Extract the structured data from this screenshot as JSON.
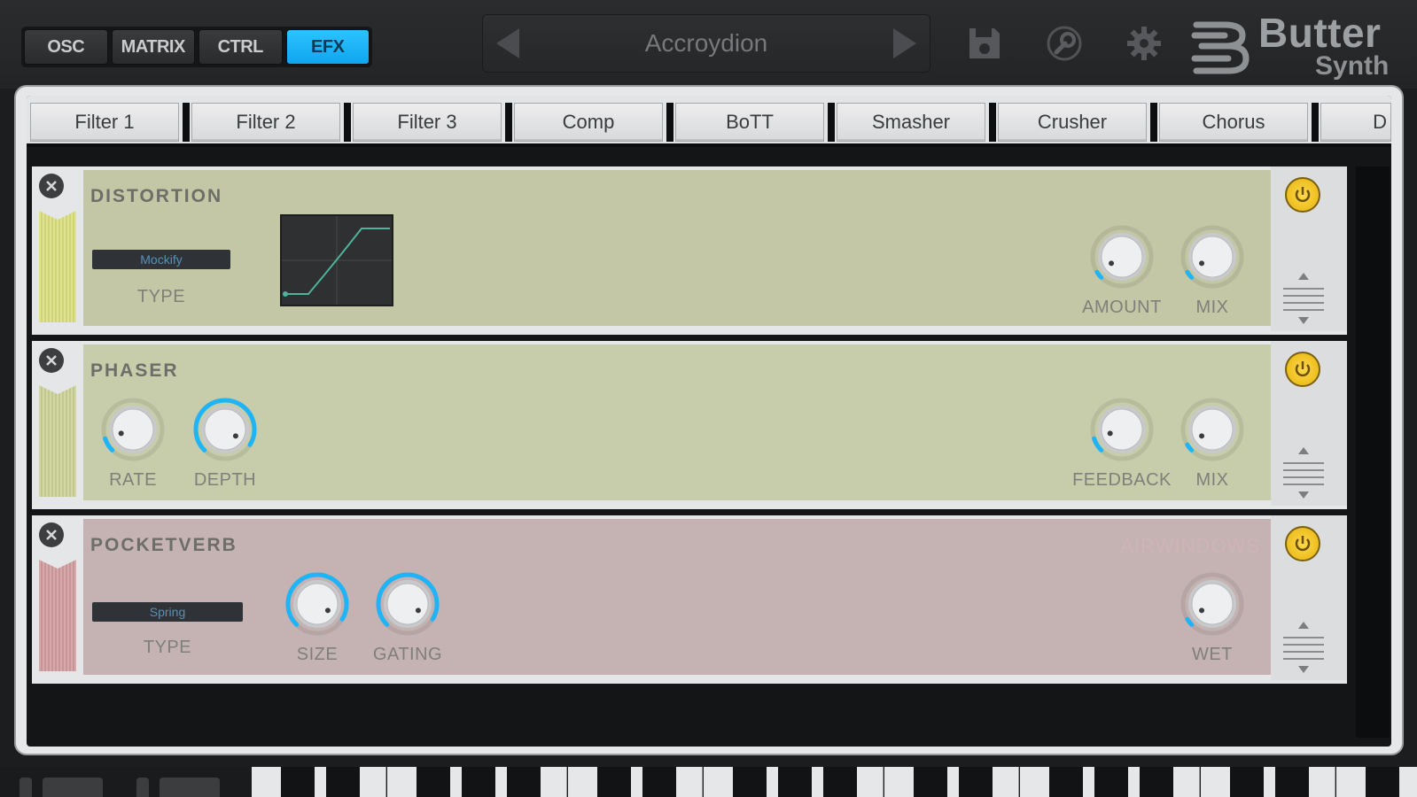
{
  "modes": {
    "items": [
      {
        "label": "OSC",
        "active": false
      },
      {
        "label": "MATRIX",
        "active": false
      },
      {
        "label": "CTRL",
        "active": false
      },
      {
        "label": "EFX",
        "active": true
      }
    ]
  },
  "preset": {
    "name": "Accroydion"
  },
  "toolbar": {
    "icons": [
      "save-icon",
      "wrench-icon",
      "gear-icon"
    ]
  },
  "logo": {
    "word1": "Butter",
    "word2": "Synth"
  },
  "tabs": [
    "Filter 1",
    "Filter 2",
    "Filter 3",
    "Comp",
    "BoTT",
    "Smasher",
    "Crusher",
    "Chorus",
    "D"
  ],
  "slots": [
    {
      "title": "DISTORTION",
      "type_value": "Mockify",
      "type_label": "TYPE",
      "knobs": [
        {
          "label": "AMOUNT",
          "value": 0.05
        },
        {
          "label": "MIX",
          "value": 0.05
        }
      ]
    },
    {
      "title": "PHASER",
      "knobs_left": [
        {
          "label": "RATE",
          "value": 0.1
        },
        {
          "label": "DEPTH",
          "value": 0.95
        }
      ],
      "knobs": [
        {
          "label": "FEEDBACK",
          "value": 0.1
        },
        {
          "label": "MIX",
          "value": 0.05
        }
      ]
    },
    {
      "title": "POCKETVERB",
      "watermark": "AIRWINDOWS",
      "type_value": "Spring",
      "type_label": "TYPE",
      "knobs_left": [
        {
          "label": "SIZE",
          "value": 0.95
        },
        {
          "label": "GATING",
          "value": 0.95
        }
      ],
      "knobs": [
        {
          "label": "WET",
          "value": 0.05
        }
      ]
    }
  ],
  "colors": {
    "accent": "#1fb4f8",
    "distortion_bg": "#c4c7a5",
    "phaser_bg": "#c7ccab",
    "pocketverb_bg": "#c5b3b3",
    "power": "#f5c518"
  }
}
